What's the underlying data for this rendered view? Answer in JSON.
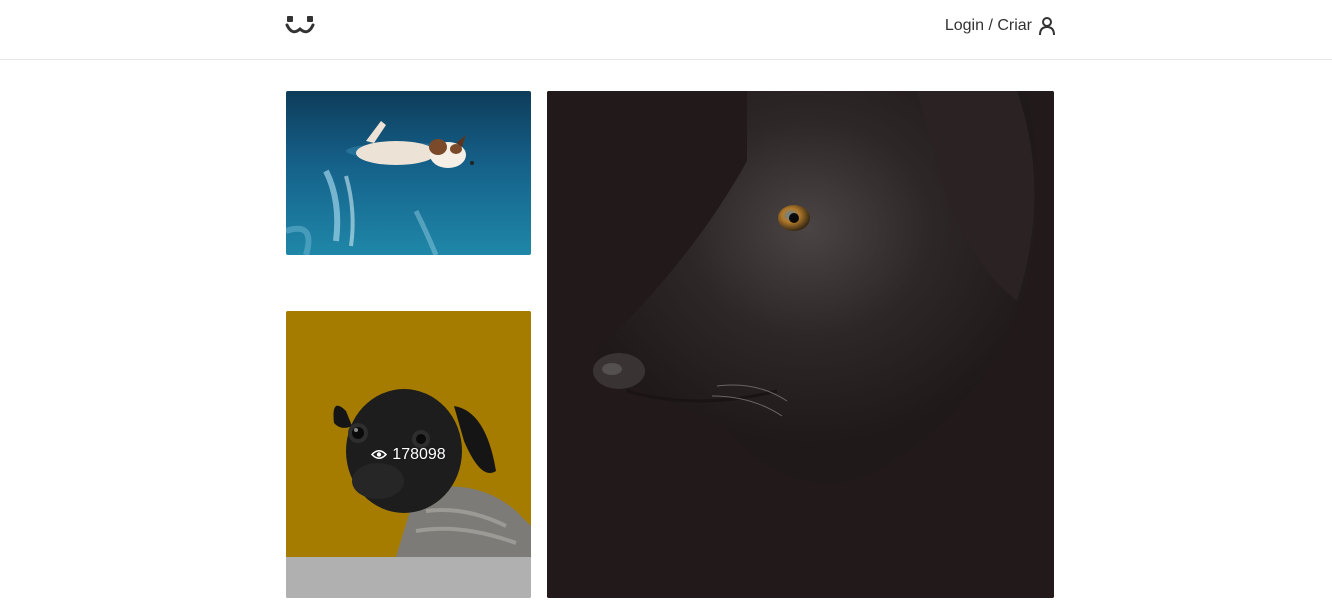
{
  "header": {
    "logo_icon": "dog-face-logo-icon",
    "login_label": "Login / Criar",
    "user_icon": "user-icon"
  },
  "feed": {
    "items": [
      {
        "subject": "dog-swimming-pool",
        "views": ""
      },
      {
        "subject": "black-pug-sweater",
        "views": "178098"
      },
      {
        "subject": "black-labrador-closeup",
        "views": ""
      }
    ]
  },
  "colors": {
    "border": "#e6e6e6",
    "text": "#333333",
    "pug_background": "#a67c00",
    "placeholder": "#b0b0b0",
    "dark_photo": "#221a1a"
  }
}
